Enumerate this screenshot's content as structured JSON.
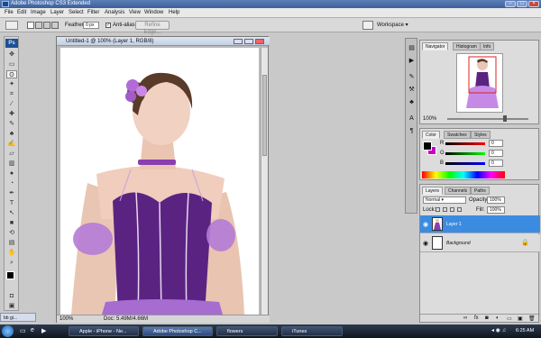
{
  "app": {
    "title": "Adobe Photoshop CS3 Extended"
  },
  "menu": [
    "File",
    "Edit",
    "Image",
    "Layer",
    "Select",
    "Filter",
    "Analysis",
    "View",
    "Window",
    "Help"
  ],
  "options": {
    "feather_label": "Feather:",
    "feather_value": "0 px",
    "antialias_label": "Anti-alias",
    "refine_label": "Refine Edge...",
    "workspace_label": "Workspace"
  },
  "toolbox": {
    "logo": "Ps"
  },
  "document": {
    "title": "Untitled-1 @ 100% (Layer 1, RGB/8)",
    "zoom": "100%",
    "doc_info": "Doc: 5.49M/4.66M"
  },
  "navigator": {
    "tabs": [
      "Navigator",
      "Histogram",
      "Info"
    ],
    "zoom": "100%"
  },
  "color_panel": {
    "tabs": [
      "Color",
      "Swatches",
      "Styles"
    ],
    "r_label": "R",
    "g_label": "G",
    "b_label": "B",
    "r_value": "0",
    "g_value": "0",
    "b_value": "0"
  },
  "layers_panel": {
    "tabs": [
      "Layers",
      "Channels",
      "Paths"
    ],
    "blend_mode": "Normal",
    "opacity_label": "Opacity:",
    "opacity_value": "100%",
    "lock_label": "Lock:",
    "fill_label": "Fill:",
    "fill_value": "100%",
    "layers": [
      "Layer 1",
      "Background"
    ]
  },
  "taskbar": {
    "minimized_doc": "bb gi...",
    "tasks": [
      "Apple - iPhone - Ne...",
      "Adobe Photoshop C...",
      "flowers",
      "iTunes"
    ],
    "clock": "6:25 AM"
  },
  "colors": {
    "accent": "#3b8ce0",
    "dress": "#5b2381",
    "sleeve": "#b57bd6"
  }
}
